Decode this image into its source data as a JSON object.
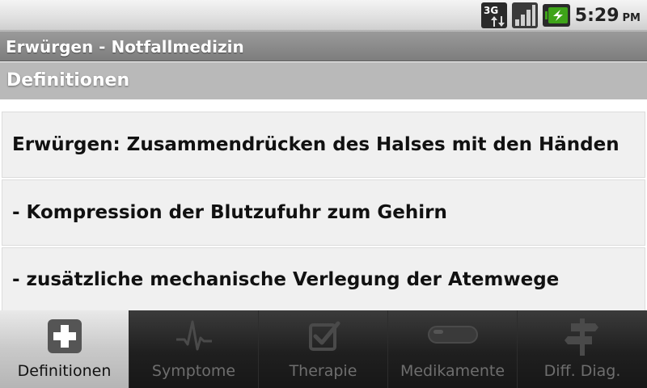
{
  "status_bar": {
    "network": "3G",
    "time": "5:29",
    "ampm": "PM"
  },
  "app": {
    "title": "Erwürgen - Notfallmedizin"
  },
  "section": {
    "header": "Definitionen"
  },
  "items": [
    "Erwürgen: Zusammendrücken des Halses mit den Händen",
    "-  Kompression der Blutzufuhr zum Gehirn",
    "-  zusätzliche mechanische Verlegung der Atemwege"
  ],
  "tabs": [
    {
      "label": "Definitionen",
      "icon": "plus-icon",
      "active": true
    },
    {
      "label": "Symptome",
      "icon": "heartbeat-icon",
      "active": false
    },
    {
      "label": "Therapie",
      "icon": "checkbox-icon",
      "active": false
    },
    {
      "label": "Medikamente",
      "icon": "pill-icon",
      "active": false
    },
    {
      "label": "Diff. Diag.",
      "icon": "signpost-icon",
      "active": false
    }
  ],
  "colors": {
    "active_tab_bg": "#c9c9c9",
    "inactive_tab_bg": "#1f1f1f",
    "battery_green": "#3ea419",
    "title_bar_bg": "#8a8a8a",
    "section_header_bg": "#b9b9b9"
  }
}
